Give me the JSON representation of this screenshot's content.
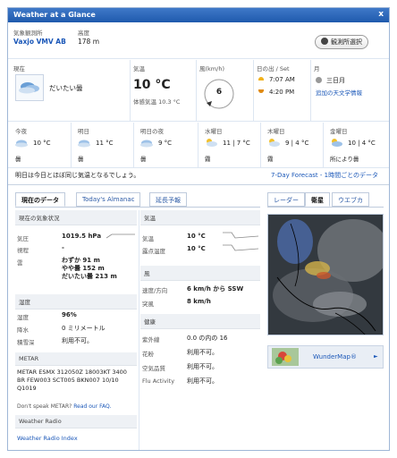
{
  "header": {
    "title": "Weather at a Glance",
    "close": "x"
  },
  "station": {
    "label": "気象観測所",
    "name": "Vaxjo VMV AB",
    "elev_label": "高度",
    "elev": "178 m",
    "change_button": "観測所選択"
  },
  "now": {
    "label": "現在",
    "cond": "だいたい曇",
    "temp_label": "気温",
    "temp": "10 °C",
    "feels": "体感気温 10.3 °C",
    "wind_label": "風(km/h)",
    "wind": "6",
    "sun_label": "日の出 / Set",
    "sunrise": "7:07 AM",
    "sunset": "4:20 PM",
    "moon_label": "月",
    "moon_phase": "三日月",
    "moon_link": "追加の天文学情報"
  },
  "forecast": [
    {
      "day": "今夜",
      "temp": "10 °C",
      "cond": "曇"
    },
    {
      "day": "明日",
      "temp": "11 °C",
      "cond": "曇"
    },
    {
      "day": "明日の夜",
      "temp": "9 °C",
      "cond": "曇"
    },
    {
      "day": "水曜日",
      "temp": "11 | 7 °C",
      "cond": "霧"
    },
    {
      "day": "木曜日",
      "temp": "9 | 4 °C",
      "cond": "霧"
    },
    {
      "day": "金曜日",
      "temp": "10 | 4 °C",
      "cond": "所により曇"
    }
  ],
  "summary": {
    "text": "明日は今日とほぼ同じ気温となるでしょう。",
    "link": "7-Day Forecast - 1時間ごとのデータ"
  },
  "tabs": [
    "現在のデータ",
    "Today's Almanac",
    "延長予報"
  ],
  "map_tabs": [
    "レーダー",
    "衛星",
    "ウエブカ"
  ],
  "conditions": {
    "head": "現在の気象状況",
    "pressure_label": "気圧",
    "pressure": "1019.5 hPa",
    "vis_label": "視程",
    "vis": "-",
    "clouds_label": "雲",
    "clouds": [
      "わずか 91 m",
      "やや曇 152 m",
      "だいたい曇 213 m"
    ]
  },
  "temperature": {
    "head": "気温",
    "temp_label": "気温",
    "temp": "10 °C",
    "dew_label": "露点温度",
    "dew": "10 °C"
  },
  "wind": {
    "head": "風",
    "speed_label": "速度/方向",
    "speed": "6 km/h から SSW",
    "gust_label": "突風",
    "gust": "8 km/h"
  },
  "humidity": {
    "head": "湿度",
    "rh_label": "湿度",
    "rh": "96%",
    "precip_label": "降水",
    "precip": "0 ミリメートル",
    "snow_label": "積雪深",
    "snow": "利用不可。"
  },
  "health": {
    "head": "健康",
    "uv_label": "紫外線",
    "uv": "0.0 の内の 16",
    "pollen_label": "花粉",
    "pollen": "利用不可。",
    "air_label": "空気品質",
    "air": "利用不可。",
    "flu_label": "Flu Activity",
    "flu": "利用不可。"
  },
  "metar": {
    "head": "METAR",
    "text": "METAR ESMX 312050Z 18003KT 3400 BR FEW003 SCT005 BKN007 10/10 Q1019",
    "faq_prefix": "Don't speak METAR? ",
    "faq_link": "Read our FAQ."
  },
  "radio": {
    "head": "Weather Radio",
    "link": "Weather Radio Index"
  },
  "wundermap": {
    "label": "WunderMap®",
    "arrow": "►"
  },
  "colors": {
    "header": "#1f5aad",
    "link": "#1a57b8",
    "accent": "#d08a00"
  }
}
